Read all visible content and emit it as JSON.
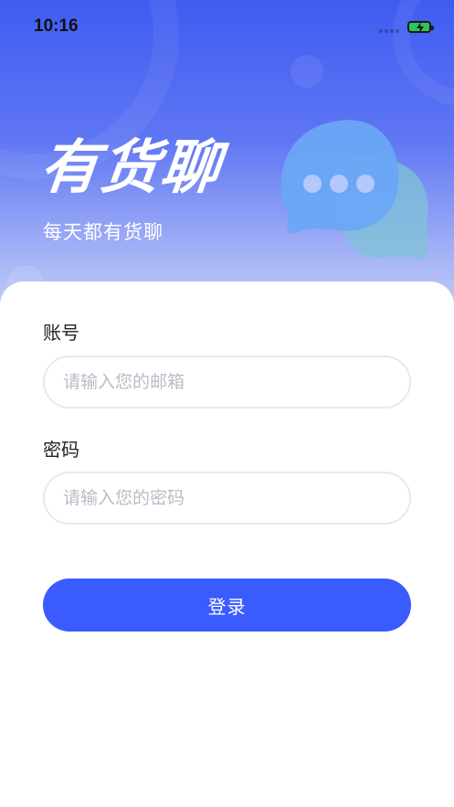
{
  "status_bar": {
    "time": "10:16",
    "signal_icon": "signal-dots-icon",
    "battery_icon": "battery-charging-icon"
  },
  "hero": {
    "app_name": "有货聊",
    "slogan": "每天都有货聊",
    "illustration_icon": "chat-bubbles-icon"
  },
  "form": {
    "account": {
      "label": "账号",
      "placeholder": "请输入您的邮箱",
      "value": ""
    },
    "password": {
      "label": "密码",
      "placeholder": "请输入您的密码",
      "value": ""
    },
    "login_label": "登录"
  },
  "colors": {
    "primary": "#3a5cff",
    "hero_top": "#3f5cf2",
    "hero_bottom": "#c2ccf7",
    "battery": "#2ec45a"
  }
}
